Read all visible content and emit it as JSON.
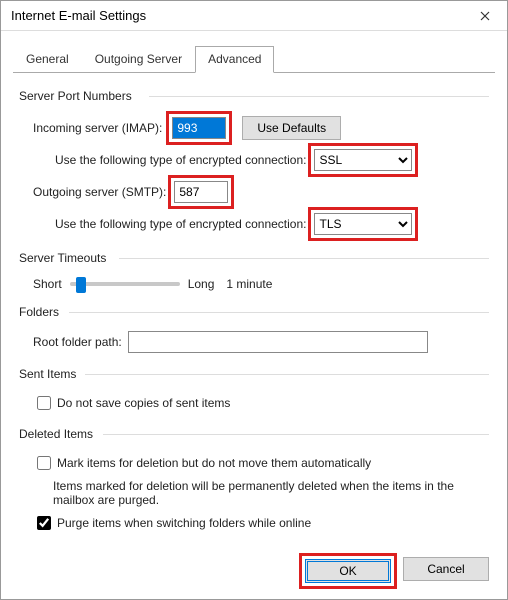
{
  "window": {
    "title": "Internet E-mail Settings"
  },
  "tabs": {
    "general": "General",
    "outgoing": "Outgoing Server",
    "advanced": "Advanced"
  },
  "serverPorts": {
    "group": "Server Port Numbers",
    "incomingLabel": "Incoming server (IMAP):",
    "incomingValue": "993",
    "useDefaults": "Use Defaults",
    "encLabel": "Use the following type of encrypted connection:",
    "incomingEnc": "SSL",
    "outgoingLabel": "Outgoing server (SMTP):",
    "outgoingValue": "587",
    "outgoingEnc": "TLS"
  },
  "timeouts": {
    "group": "Server Timeouts",
    "short": "Short",
    "long": "Long",
    "value": "1 minute"
  },
  "folders": {
    "group": "Folders",
    "rootLabel": "Root folder path:",
    "rootValue": ""
  },
  "sentItems": {
    "group": "Sent Items",
    "noSave": "Do not save copies of sent items"
  },
  "deletedItems": {
    "group": "Deleted Items",
    "mark": "Mark items for deletion but do not move them automatically",
    "note": "Items marked for deletion will be permanently deleted when the items in the mailbox are purged.",
    "purge": "Purge items when switching folders while online"
  },
  "buttons": {
    "ok": "OK",
    "cancel": "Cancel"
  }
}
